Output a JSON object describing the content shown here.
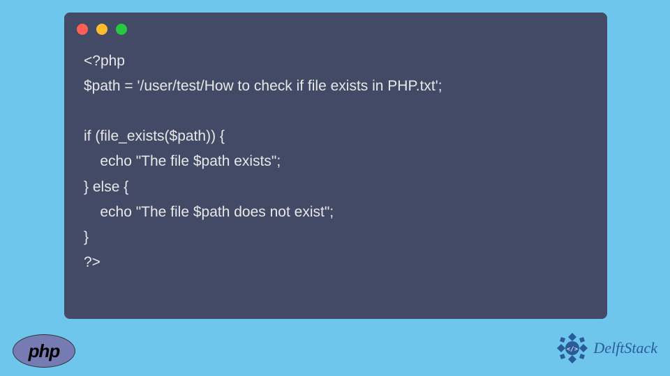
{
  "code": {
    "lines": [
      "<?php",
      "$path = '/user/test/How to check if file exists in PHP.txt';",
      "",
      "if (file_exists($path)) {",
      "    echo \"The file $path exists\";",
      "} else {",
      "    echo \"The file $path does not exist\";",
      "}",
      "?>"
    ]
  },
  "logos": {
    "php": "php",
    "delftstack": "DelftStack"
  },
  "colors": {
    "background": "#6fc6ed",
    "codeWindow": "#424a65",
    "codeText": "#e8e8e8",
    "phpLogo": "#777bb3",
    "delftBlue": "#2a5c9a"
  }
}
